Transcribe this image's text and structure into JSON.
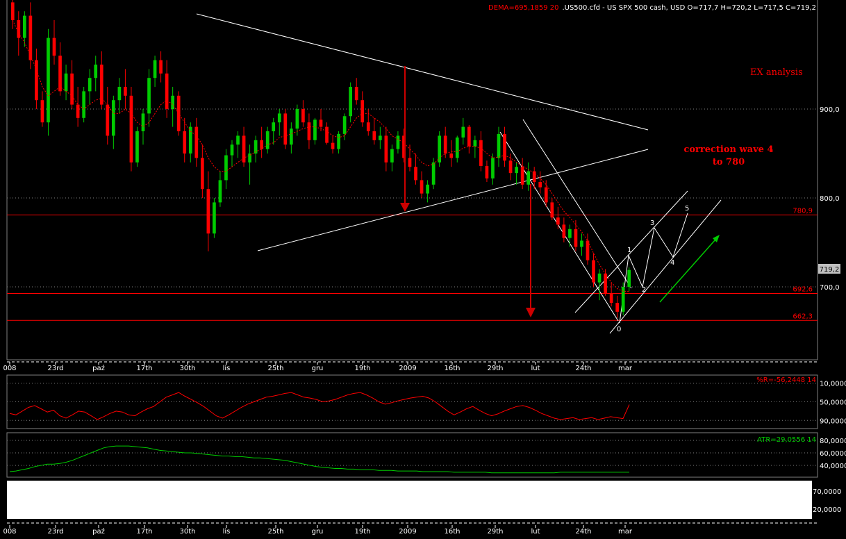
{
  "chart_data": [
    {
      "type": "candlestick",
      "name": "main",
      "header": {
        "indicator": "DEMA=695,1859  20",
        "instrument": ".US500.cfd - US SPX 500 cash, USD O=717,7 H=720,2 L=717,5 C=719,2"
      },
      "ylim": [
        630,
        1030
      ],
      "yticks": [
        {
          "v": 900,
          "label": "900,0"
        },
        {
          "v": 800,
          "label": "800,0"
        },
        {
          "v": 700,
          "label": "700,0"
        }
      ],
      "levels": [
        {
          "v": 780.9,
          "label": "780,9",
          "color": "#ff0000"
        },
        {
          "v": 692.6,
          "label": "692,6",
          "color": "#ff0000"
        },
        {
          "v": 662.3,
          "label": "662,3",
          "color": "#ff0000"
        }
      ],
      "last_price_label": "719,2",
      "xlabels": [
        "008",
        "23rd",
        "paź",
        "17th",
        "30th",
        "lis",
        "25th",
        "gru",
        "19th",
        "2009",
        "16th",
        "29th",
        "lut",
        "24th",
        "mar"
      ],
      "candles": [
        [
          1020,
          1030,
          990,
          1000
        ],
        [
          1000,
          1010,
          960,
          980
        ],
        [
          980,
          1010,
          970,
          1005
        ],
        [
          1005,
          1020,
          945,
          955
        ],
        [
          955,
          968,
          900,
          910
        ],
        [
          910,
          920,
          880,
          885
        ],
        [
          885,
          990,
          870,
          980
        ],
        [
          980,
          1000,
          950,
          960
        ],
        [
          960,
          975,
          915,
          920
        ],
        [
          920,
          950,
          910,
          940
        ],
        [
          940,
          955,
          900,
          905
        ],
        [
          905,
          925,
          880,
          890
        ],
        [
          890,
          925,
          885,
          920
        ],
        [
          920,
          945,
          905,
          935
        ],
        [
          935,
          960,
          920,
          950
        ],
        [
          950,
          965,
          900,
          905
        ],
        [
          905,
          925,
          860,
          870
        ],
        [
          870,
          915,
          855,
          910
        ],
        [
          910,
          935,
          895,
          925
        ],
        [
          925,
          945,
          900,
          915
        ],
        [
          915,
          925,
          830,
          840
        ],
        [
          840,
          880,
          835,
          875
        ],
        [
          875,
          900,
          860,
          895
        ],
        [
          895,
          945,
          880,
          935
        ],
        [
          935,
          960,
          925,
          955
        ],
        [
          955,
          965,
          930,
          940
        ],
        [
          940,
          955,
          890,
          900
        ],
        [
          900,
          925,
          880,
          915
        ],
        [
          915,
          920,
          870,
          875
        ],
        [
          875,
          890,
          840,
          850
        ],
        [
          850,
          885,
          840,
          880
        ],
        [
          880,
          890,
          835,
          845
        ],
        [
          845,
          860,
          800,
          810
        ],
        [
          810,
          830,
          740,
          760
        ],
        [
          760,
          800,
          755,
          795
        ],
        [
          795,
          830,
          790,
          820
        ],
        [
          820,
          855,
          810,
          848
        ],
        [
          848,
          865,
          835,
          860
        ],
        [
          860,
          875,
          845,
          870
        ],
        [
          870,
          880,
          835,
          840
        ],
        [
          840,
          860,
          815,
          850
        ],
        [
          850,
          870,
          840,
          865
        ],
        [
          865,
          880,
          845,
          855
        ],
        [
          855,
          880,
          850,
          875
        ],
        [
          875,
          890,
          860,
          885
        ],
        [
          885,
          900,
          870,
          895
        ],
        [
          895,
          900,
          855,
          860
        ],
        [
          860,
          885,
          850,
          878
        ],
        [
          878,
          905,
          870,
          900
        ],
        [
          900,
          910,
          880,
          885
        ],
        [
          885,
          895,
          855,
          865
        ],
        [
          865,
          890,
          860,
          888
        ],
        [
          888,
          900,
          875,
          880
        ],
        [
          880,
          885,
          860,
          862
        ],
        [
          862,
          870,
          850,
          855
        ],
        [
          855,
          875,
          850,
          872
        ],
        [
          872,
          895,
          865,
          892
        ],
        [
          892,
          930,
          885,
          925
        ],
        [
          925,
          935,
          905,
          910
        ],
        [
          910,
          920,
          880,
          885
        ],
        [
          885,
          900,
          870,
          875
        ],
        [
          875,
          890,
          860,
          865
        ],
        [
          865,
          880,
          855,
          870
        ],
        [
          870,
          880,
          830,
          840
        ],
        [
          840,
          860,
          830,
          855
        ],
        [
          855,
          875,
          850,
          870
        ],
        [
          870,
          878,
          840,
          845
        ],
        [
          845,
          860,
          830,
          835
        ],
        [
          835,
          850,
          815,
          820
        ],
        [
          820,
          830,
          800,
          805
        ],
        [
          805,
          820,
          795,
          815
        ],
        [
          815,
          845,
          810,
          840
        ],
        [
          840,
          875,
          835,
          870
        ],
        [
          870,
          880,
          845,
          850
        ],
        [
          850,
          865,
          835,
          845
        ],
        [
          845,
          870,
          840,
          868
        ],
        [
          868,
          890,
          860,
          880
        ],
        [
          880,
          882,
          850,
          858
        ],
        [
          858,
          870,
          845,
          865
        ],
        [
          865,
          875,
          830,
          836
        ],
        [
          836,
          842,
          818,
          822
        ],
        [
          822,
          850,
          815,
          845
        ],
        [
          845,
          880,
          835,
          872
        ],
        [
          872,
          880,
          835,
          842
        ],
        [
          842,
          850,
          820,
          828
        ],
        [
          828,
          840,
          815,
          835
        ],
        [
          835,
          845,
          810,
          815
        ],
        [
          815,
          840,
          808,
          830
        ],
        [
          830,
          835,
          810,
          818
        ],
        [
          818,
          830,
          805,
          812
        ],
        [
          812,
          820,
          790,
          795
        ],
        [
          795,
          800,
          775,
          778
        ],
        [
          778,
          790,
          765,
          770
        ],
        [
          770,
          778,
          750,
          755
        ],
        [
          755,
          770,
          745,
          765
        ],
        [
          765,
          775,
          740,
          745
        ],
        [
          745,
          760,
          735,
          752
        ],
        [
          752,
          760,
          725,
          730
        ],
        [
          730,
          738,
          700,
          705
        ],
        [
          705,
          720,
          685,
          715
        ],
        [
          715,
          720,
          690,
          693
        ],
        [
          693,
          705,
          678,
          682
        ],
        [
          682,
          690,
          665,
          672
        ],
        [
          672,
          705,
          668,
          700
        ],
        [
          700,
          722,
          695,
          719
        ]
      ],
      "dema": [
        1000,
        985,
        975,
        960,
        945,
        925,
        915,
        920,
        925,
        920,
        915,
        905,
        900,
        905,
        910,
        912,
        905,
        895,
        895,
        900,
        895,
        885,
        880,
        885,
        895,
        905,
        910,
        905,
        895,
        885,
        875,
        870,
        860,
        845,
        835,
        830,
        830,
        835,
        840,
        845,
        848,
        852,
        855,
        860,
        862,
        868,
        870,
        872,
        875,
        878,
        880,
        880,
        878,
        875,
        870,
        868,
        870,
        880,
        890,
        895,
        895,
        890,
        885,
        878,
        870,
        866,
        862,
        855,
        848,
        840,
        836,
        838,
        845,
        850,
        852,
        852,
        856,
        858,
        858,
        856,
        850,
        845,
        846,
        848,
        845,
        840,
        836,
        832,
        828,
        822,
        815,
        805,
        795,
        785,
        778,
        770,
        762,
        752,
        738,
        725,
        715,
        705,
        698,
        695,
        695
      ]
    },
    {
      "type": "line",
      "name": "williams_r",
      "label": "%R=-56,2448  14",
      "yticks": [
        "10,0000",
        "50,0000",
        "90,0000"
      ],
      "values": [
        75,
        78,
        70,
        62,
        58,
        65,
        72,
        68,
        80,
        85,
        78,
        70,
        72,
        80,
        88,
        82,
        75,
        70,
        72,
        78,
        80,
        72,
        65,
        60,
        50,
        40,
        35,
        30,
        38,
        45,
        52,
        60,
        70,
        80,
        85,
        78,
        70,
        62,
        55,
        50,
        45,
        40,
        38,
        35,
        32,
        30,
        35,
        40,
        42,
        45,
        50,
        48,
        45,
        40,
        35,
        32,
        30,
        35,
        42,
        50,
        55,
        52,
        48,
        45,
        42,
        40,
        38,
        42,
        50,
        60,
        70,
        78,
        72,
        65,
        60,
        68,
        75,
        80,
        76,
        70,
        65,
        60,
        58,
        62,
        68,
        75,
        80,
        85,
        88,
        86,
        84,
        88,
        86,
        84,
        88,
        85,
        82,
        84,
        86,
        56
      ]
    },
    {
      "type": "line",
      "name": "atr",
      "label": "ATR=29,0556  14",
      "yticks": [
        "80,0000",
        "60,0000",
        "40,0000"
      ],
      "values": [
        30,
        31,
        33,
        35,
        38,
        40,
        42,
        42,
        43,
        45,
        48,
        52,
        56,
        60,
        64,
        68,
        70,
        71,
        71,
        71,
        70,
        69,
        68,
        66,
        64,
        63,
        62,
        61,
        60,
        60,
        59,
        58,
        57,
        56,
        55,
        55,
        54,
        54,
        53,
        52,
        52,
        51,
        50,
        49,
        48,
        46,
        44,
        42,
        40,
        38,
        37,
        36,
        35,
        35,
        34,
        34,
        33,
        33,
        33,
        32,
        32,
        32,
        31,
        31,
        31,
        31,
        30,
        30,
        30,
        30,
        30,
        29,
        29,
        29,
        29,
        29,
        29,
        28,
        28,
        28,
        28,
        28,
        28,
        28,
        28,
        28,
        28,
        28,
        29,
        29,
        29,
        29,
        29,
        29,
        29,
        29,
        29,
        29,
        29,
        29
      ]
    },
    {
      "type": "line",
      "name": "empty_panel",
      "yticks": [
        "70,0000",
        "20,0000"
      ]
    }
  ],
  "annotations": {
    "ex_analysis": "EX analysis",
    "correction_line1": "correction wave 4",
    "correction_line2": "to 780",
    "wave_labels": [
      "0",
      "1",
      "2",
      "3",
      "4",
      "5"
    ]
  },
  "colors": {
    "up": "#00cc00",
    "down": "#ff0000",
    "dema": "#ff0000",
    "grid": "#808080",
    "trendline": "#ffffff",
    "projection_arrow": "#00cc00"
  }
}
